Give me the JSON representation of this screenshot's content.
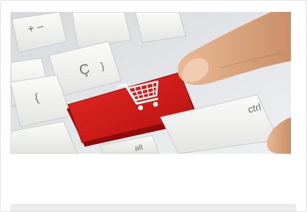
{
  "image": {
    "alt": "",
    "subject": "red shopping-cart key on a keyboard being pressed by a finger",
    "colors": {
      "cart_key": "#d81e1e",
      "keys": "#f4f4f2",
      "skin": "#e3b08a"
    }
  },
  "keys": {
    "plus_minus": "+ –",
    "c_cedilla": "Ç",
    "brace": "}",
    "ctrl": "ctrl",
    "alt": "alt",
    "brace_left": "{"
  },
  "icons": {
    "cart": "shopping-cart-icon"
  }
}
